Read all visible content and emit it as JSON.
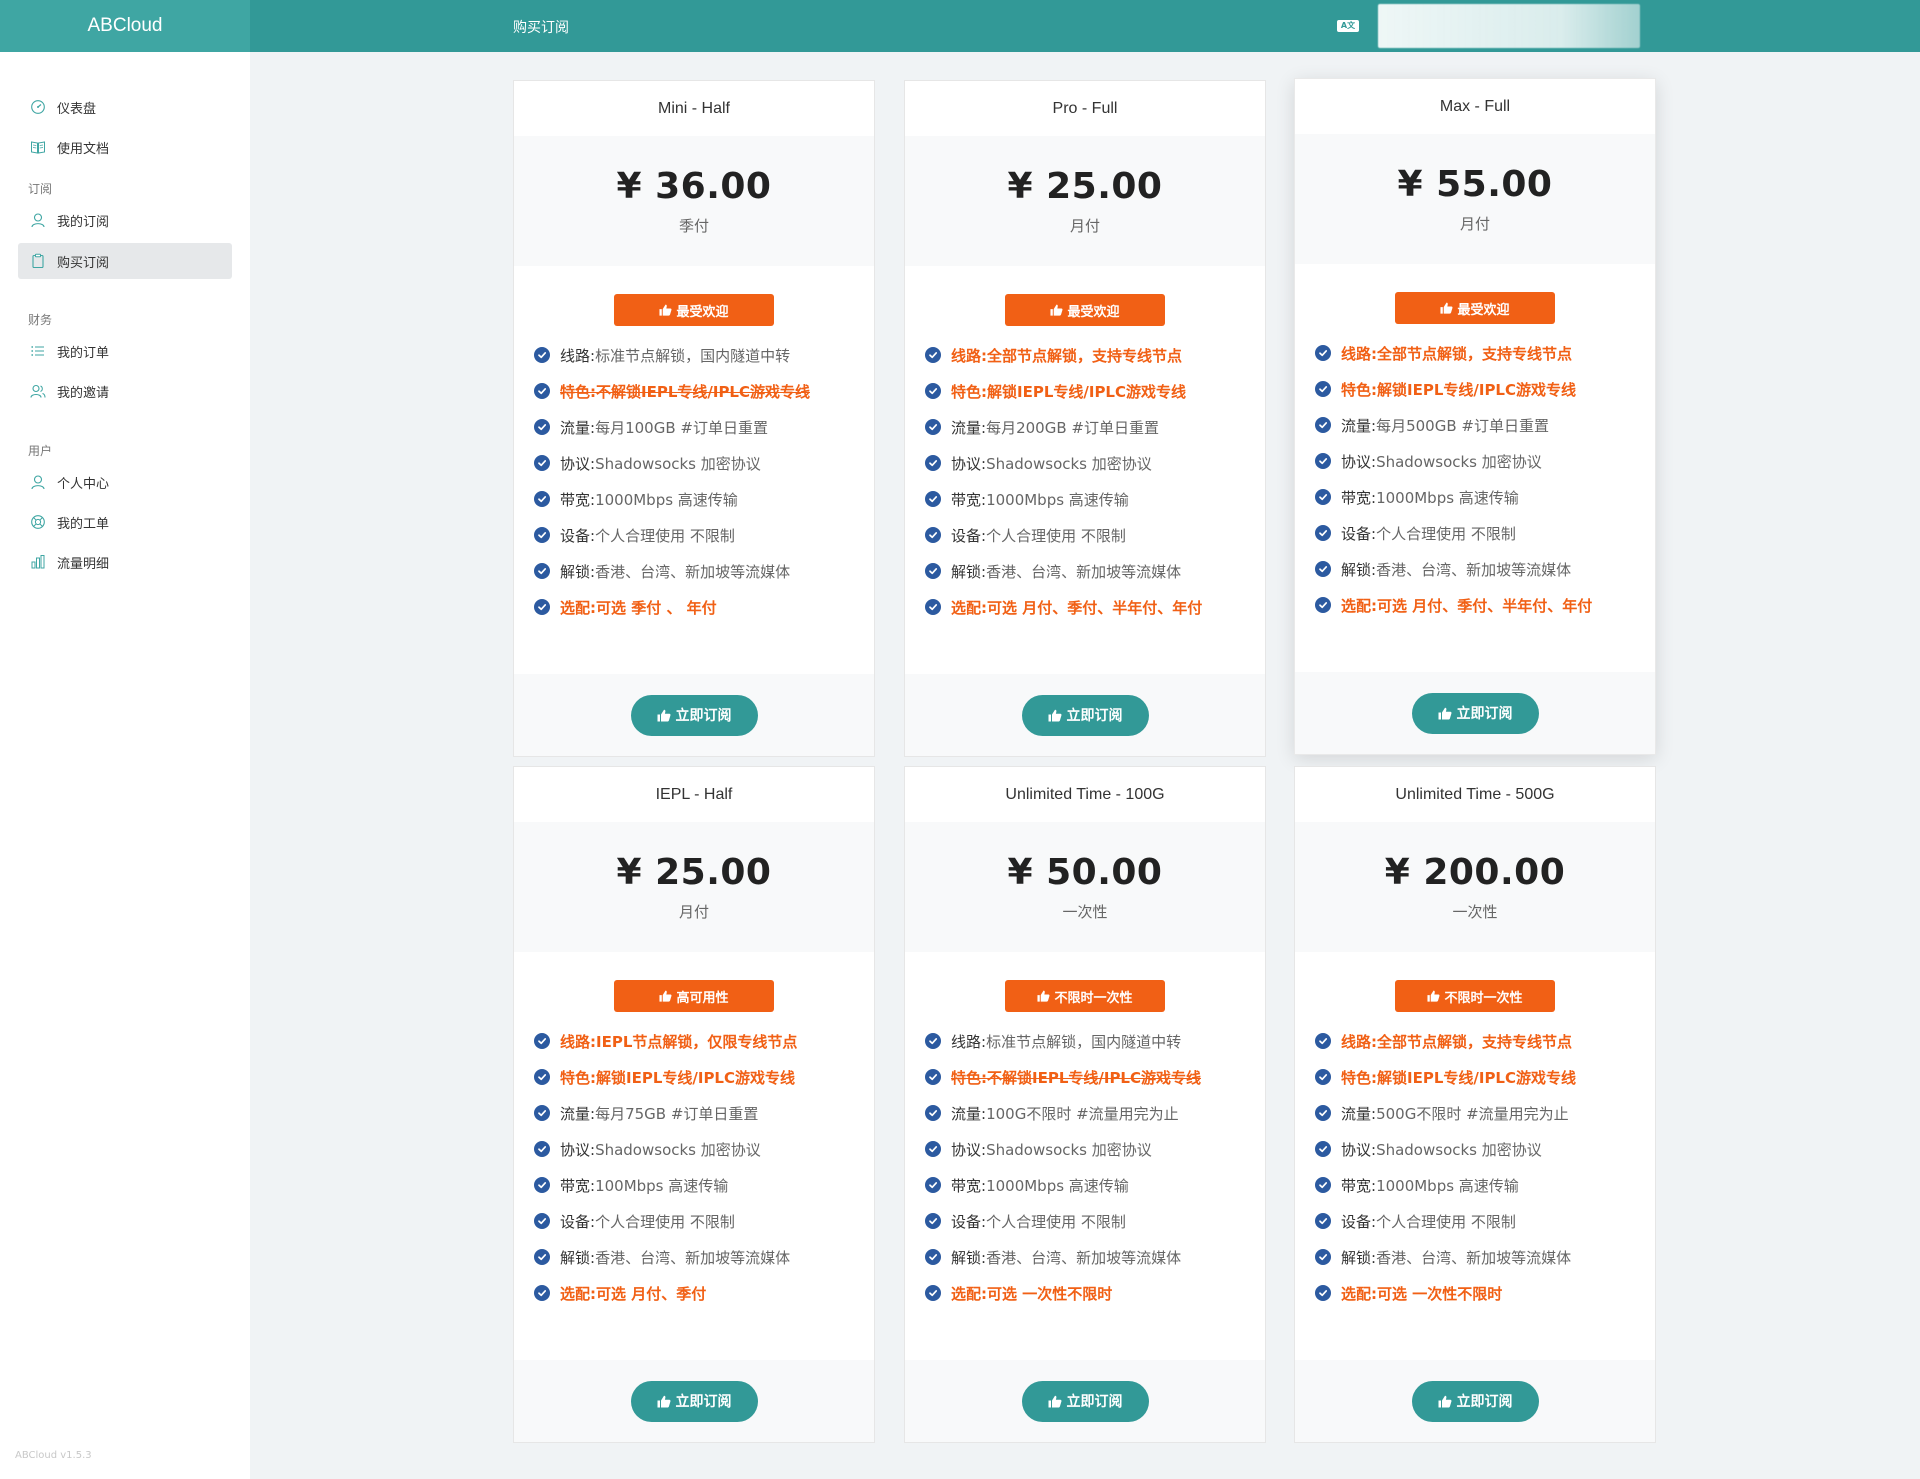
{
  "app": {
    "brand": "ABCloud",
    "page_title": "购买订阅",
    "lang_label": "A文",
    "version": "ABCloud v1.5.3"
  },
  "sidebar": {
    "items": [
      {
        "label": "仪表盘",
        "icon": "dashboard-icon"
      },
      {
        "label": "使用文档",
        "icon": "book-icon"
      }
    ],
    "groups": [
      {
        "title": "订阅",
        "items": [
          {
            "label": "我的订阅",
            "icon": "user-icon"
          },
          {
            "label": "购买订阅",
            "icon": "clipboard-icon"
          }
        ]
      },
      {
        "title": "财务",
        "items": [
          {
            "label": "我的订单",
            "icon": "list-icon"
          },
          {
            "label": "我的邀请",
            "icon": "users-icon"
          }
        ]
      },
      {
        "title": "用户",
        "items": [
          {
            "label": "个人中心",
            "icon": "person-icon"
          },
          {
            "label": "我的工单",
            "icon": "support-icon"
          },
          {
            "label": "流量明细",
            "icon": "bar-chart-icon"
          }
        ]
      }
    ],
    "active": "购买订阅"
  },
  "colors": {
    "header": "#329997",
    "brand_bg": "#3fa6a3",
    "accent": "#329997",
    "highlight": "#f16015",
    "check": "#2c5aa0"
  },
  "subscribe_label": "立即订阅",
  "plans": [
    {
      "name": "Mini - Half",
      "price": "¥ 36.00",
      "period": "季付",
      "badge": "最受欢迎",
      "features": [
        {
          "key": "线路:",
          "val": "标准节点解锁，国内隧道中转",
          "style": "normal"
        },
        {
          "key": "特色:",
          "val": "不解锁IEPL专线/IPLC游戏专线",
          "style": "strike"
        },
        {
          "key": "流量:",
          "val": "每月100GB #订单日重置",
          "style": "normal"
        },
        {
          "key": "协议:",
          "val": "Shadowsocks 加密协议",
          "style": "normal"
        },
        {
          "key": "带宽:",
          "val": "1000Mbps 高速传输",
          "style": "normal"
        },
        {
          "key": "设备:",
          "val": "个人合理使用 不限制",
          "style": "normal"
        },
        {
          "key": "解锁:",
          "val": "香港、台湾、新加坡等流媒体",
          "style": "normal"
        },
        {
          "key": "选配:",
          "val": "可选 季付 、 年付",
          "style": "hl"
        }
      ]
    },
    {
      "name": "Pro - Full",
      "price": "¥ 25.00",
      "period": "月付",
      "badge": "最受欢迎",
      "features": [
        {
          "key": "线路:",
          "val": "全部节点解锁，支持专线节点",
          "style": "hl"
        },
        {
          "key": "特色:",
          "val": "解锁IEPL专线/IPLC游戏专线",
          "style": "hl"
        },
        {
          "key": "流量:",
          "val": "每月200GB #订单日重置",
          "style": "normal"
        },
        {
          "key": "协议:",
          "val": "Shadowsocks 加密协议",
          "style": "normal"
        },
        {
          "key": "带宽:",
          "val": "1000Mbps 高速传输",
          "style": "normal"
        },
        {
          "key": "设备:",
          "val": "个人合理使用 不限制",
          "style": "normal"
        },
        {
          "key": "解锁:",
          "val": "香港、台湾、新加坡等流媒体",
          "style": "normal"
        },
        {
          "key": "选配:",
          "val": "可选 月付、季付、半年付、年付",
          "style": "hl"
        }
      ]
    },
    {
      "name": "Max - Full",
      "price": "¥ 55.00",
      "period": "月付",
      "badge": "最受欢迎",
      "features": [
        {
          "key": "线路:",
          "val": "全部节点解锁，支持专线节点",
          "style": "hl"
        },
        {
          "key": "特色:",
          "val": "解锁IEPL专线/IPLC游戏专线",
          "style": "hl"
        },
        {
          "key": "流量:",
          "val": "每月500GB #订单日重置",
          "style": "normal"
        },
        {
          "key": "协议:",
          "val": "Shadowsocks 加密协议",
          "style": "normal"
        },
        {
          "key": "带宽:",
          "val": "1000Mbps 高速传输",
          "style": "normal"
        },
        {
          "key": "设备:",
          "val": "个人合理使用 不限制",
          "style": "normal"
        },
        {
          "key": "解锁:",
          "val": "香港、台湾、新加坡等流媒体",
          "style": "normal"
        },
        {
          "key": "选配:",
          "val": "可选 月付、季付、半年付、年付",
          "style": "hl"
        }
      ]
    },
    {
      "name": "IEPL - Half",
      "price": "¥ 25.00",
      "period": "月付",
      "badge": "高可用性",
      "features": [
        {
          "key": "线路:",
          "val": "IEPL节点解锁，仅限专线节点",
          "style": "hl"
        },
        {
          "key": "特色:",
          "val": "解锁IEPL专线/IPLC游戏专线",
          "style": "hl"
        },
        {
          "key": "流量:",
          "val": "每月75GB #订单日重置",
          "style": "normal"
        },
        {
          "key": "协议:",
          "val": "Shadowsocks 加密协议",
          "style": "normal"
        },
        {
          "key": "带宽:",
          "val": "100Mbps 高速传输",
          "style": "normal"
        },
        {
          "key": "设备:",
          "val": "个人合理使用 不限制",
          "style": "normal"
        },
        {
          "key": "解锁:",
          "val": "香港、台湾、新加坡等流媒体",
          "style": "normal"
        },
        {
          "key": "选配:",
          "val": "可选 月付、季付",
          "style": "hl"
        }
      ]
    },
    {
      "name": "Unlimited Time - 100G",
      "price": "¥ 50.00",
      "period": "一次性",
      "badge": "不限时一次性",
      "features": [
        {
          "key": "线路:",
          "val": "标准节点解锁，国内隧道中转",
          "style": "normal"
        },
        {
          "key": "特色:",
          "val": "不解锁IEPL专线/IPLC游戏专线",
          "style": "strike"
        },
        {
          "key": "流量:",
          "val": "100G不限时 #流量用完为止",
          "style": "normal"
        },
        {
          "key": "协议:",
          "val": "Shadowsocks 加密协议",
          "style": "normal"
        },
        {
          "key": "带宽:",
          "val": "1000Mbps 高速传输",
          "style": "normal"
        },
        {
          "key": "设备:",
          "val": "个人合理使用 不限制",
          "style": "normal"
        },
        {
          "key": "解锁:",
          "val": "香港、台湾、新加坡等流媒体",
          "style": "normal"
        },
        {
          "key": "选配:",
          "val": "可选 一次性不限时",
          "style": "hl"
        }
      ]
    },
    {
      "name": "Unlimited Time - 500G",
      "price": "¥ 200.00",
      "period": "一次性",
      "badge": "不限时一次性",
      "features": [
        {
          "key": "线路:",
          "val": "全部节点解锁，支持专线节点",
          "style": "hl"
        },
        {
          "key": "特色:",
          "val": "解锁IEPL专线/IPLC游戏专线",
          "style": "hl"
        },
        {
          "key": "流量:",
          "val": "500G不限时 #流量用完为止",
          "style": "normal"
        },
        {
          "key": "协议:",
          "val": "Shadowsocks 加密协议",
          "style": "normal"
        },
        {
          "key": "带宽:",
          "val": "1000Mbps 高速传输",
          "style": "normal"
        },
        {
          "key": "设备:",
          "val": "个人合理使用 不限制",
          "style": "normal"
        },
        {
          "key": "解锁:",
          "val": "香港、台湾、新加坡等流媒体",
          "style": "normal"
        },
        {
          "key": "选配:",
          "val": "可选 一次性不限时",
          "style": "hl"
        }
      ]
    }
  ]
}
